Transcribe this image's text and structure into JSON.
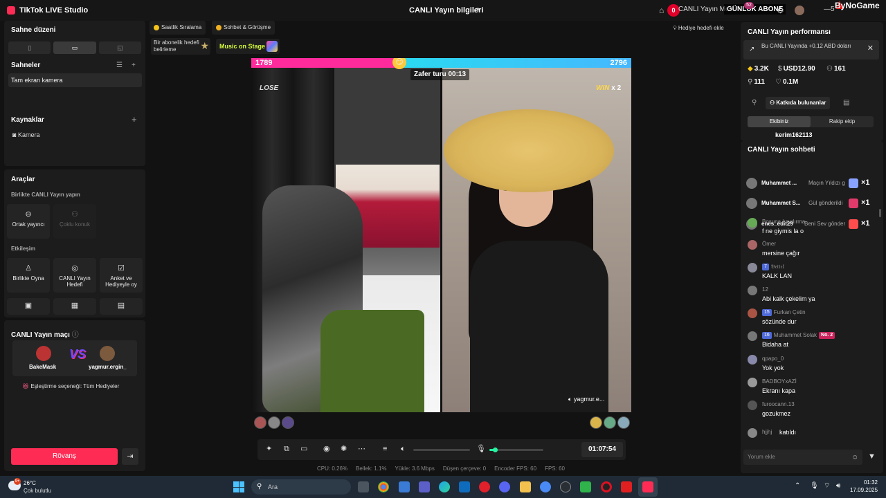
{
  "titlebar": {
    "app_name": "TikTok LIVE Studio",
    "center_title": "CANLI Yayın bilgileri",
    "notification_count": "0",
    "merkez_label": "CANLI Yayın Merkezi",
    "abone_label": "GÜNLÜK ABONE",
    "abone_badge": "52",
    "minimize_label": "—5",
    "brand": "ByNoGame"
  },
  "left": {
    "scene_layout_title": "Sahne düzeni",
    "layout_tabs": [
      "▯",
      "▭",
      "◱"
    ],
    "scenes_title": "Sahneler",
    "scene_item": "Tam ekran kamera",
    "sources_title": "Kaynaklar",
    "source_item": "Kamera",
    "tools_title": "Araçlar",
    "collab_label": "Birlikte CANLI Yayın yapın",
    "tool_cohost": "Ortak yayıncı",
    "tool_multiguest": "Çoklu konuk",
    "interaction_label": "Etkileşim",
    "tool_play": "Birlikte Oyna",
    "tool_goal": "CANLI Yayın Hedefi",
    "tool_poll": "Anket ve Hediyeyle oy",
    "match_title": "CANLI Yayın maçı",
    "player1": "BakeMask",
    "player2": "yagmur.ergin_",
    "vs": "VS",
    "matching_option": "Eşleştirme seçeneği: Tüm Hediyeler",
    "rematch": "Rövanş"
  },
  "center": {
    "pill_hourly": "Saatlik Sıralama",
    "pill_chat": "Sohbet & Görüşme",
    "sub_goal": "Bir abonelik hedefi belirleme",
    "music": "Music on Stage",
    "gift_goal": "Hediye hedefi ekle",
    "score_left": "1789",
    "score_right": "2796",
    "score_left_fraction": 0.39,
    "timer": "Zafer turu 00:13",
    "lose": "LOSE",
    "win_label": "WIN",
    "win_mult": "x 2",
    "cam_tag": "yagmur.e...",
    "elapsed": "01:07:54",
    "mic_level": 0.1,
    "stats": {
      "cpu": "CPU:  0.26%",
      "mem": "Bellek:  1.1%",
      "upload": "Yükle:  3.6 Mbps",
      "dropped": "Düşen çerçeve:  0",
      "encoder": "Encoder FPS:  60",
      "fps": "FPS:  60"
    }
  },
  "right": {
    "perf_title": "CANLI Yayın performansı",
    "info_text": "Bu CANLI Yayında +0.12 ABD doları",
    "diamonds": "3.2K",
    "usd": "USD12.90",
    "viewers": "161",
    "followers": "111",
    "likes": "0.1M",
    "contributors": "Katkıda bulunanlar",
    "team_tabs": [
      "Ekibiniz",
      "Rakip ekip"
    ],
    "top_user": "kerim162113",
    "chat_title": "CANLI Yayın sohbeti",
    "gift_rows": [
      {
        "user": "Muhammet ...",
        "text": "Maçın Yıldızı g",
        "count": "×1",
        "color": "#8aa2ff"
      },
      {
        "user": "Muhammet S...",
        "text": "Gül gönderildi",
        "count": "×1",
        "color": "#e23a6a"
      },
      {
        "user": "enes_edit29",
        "text": "Beni Sev gönder",
        "count": "×1",
        "color": "#ff4d4d"
      }
    ],
    "messages": [
      {
        "user": "Boşuna kaydırma",
        "text": "f ne giymis la o",
        "level": "",
        "no2": ""
      },
      {
        "user": "Ömer",
        "text": "mersine çağır",
        "level": "",
        "no2": ""
      },
      {
        "user": "𝔅𝔢𝔱𝔱𝔢𝔩",
        "text": "KALK LAN",
        "level": "7",
        "no2": ""
      },
      {
        "user": "12",
        "text": "Abi kalk çekelim ya",
        "level": "",
        "no2": ""
      },
      {
        "user": "Furkan Çetin",
        "text": "sözünde dur",
        "level": "15",
        "no2": ""
      },
      {
        "user": "Muhammet Solak",
        "text": "Bidaha at",
        "level": "16",
        "no2": "No. 2"
      },
      {
        "user": "qpapo_0",
        "text": "Yok yok",
        "level": "",
        "no2": ""
      },
      {
        "user": "BADBOYxAZİ",
        "text": "Ekranı kapa",
        "level": "",
        "no2": ""
      },
      {
        "user": "furoocann.13",
        "text": "gozukmez",
        "level": "",
        "no2": ""
      },
      {
        "user": "hjjhj",
        "text": "katıldı",
        "level": "",
        "no2": ""
      }
    ],
    "comment_placeholder": "Yorum ekle"
  },
  "taskbar": {
    "temp": "26°C",
    "condition": "Çok bulutlu",
    "weather_badge": "9+",
    "search": "Ara",
    "time": "01:32",
    "date": "17.09.2025"
  }
}
